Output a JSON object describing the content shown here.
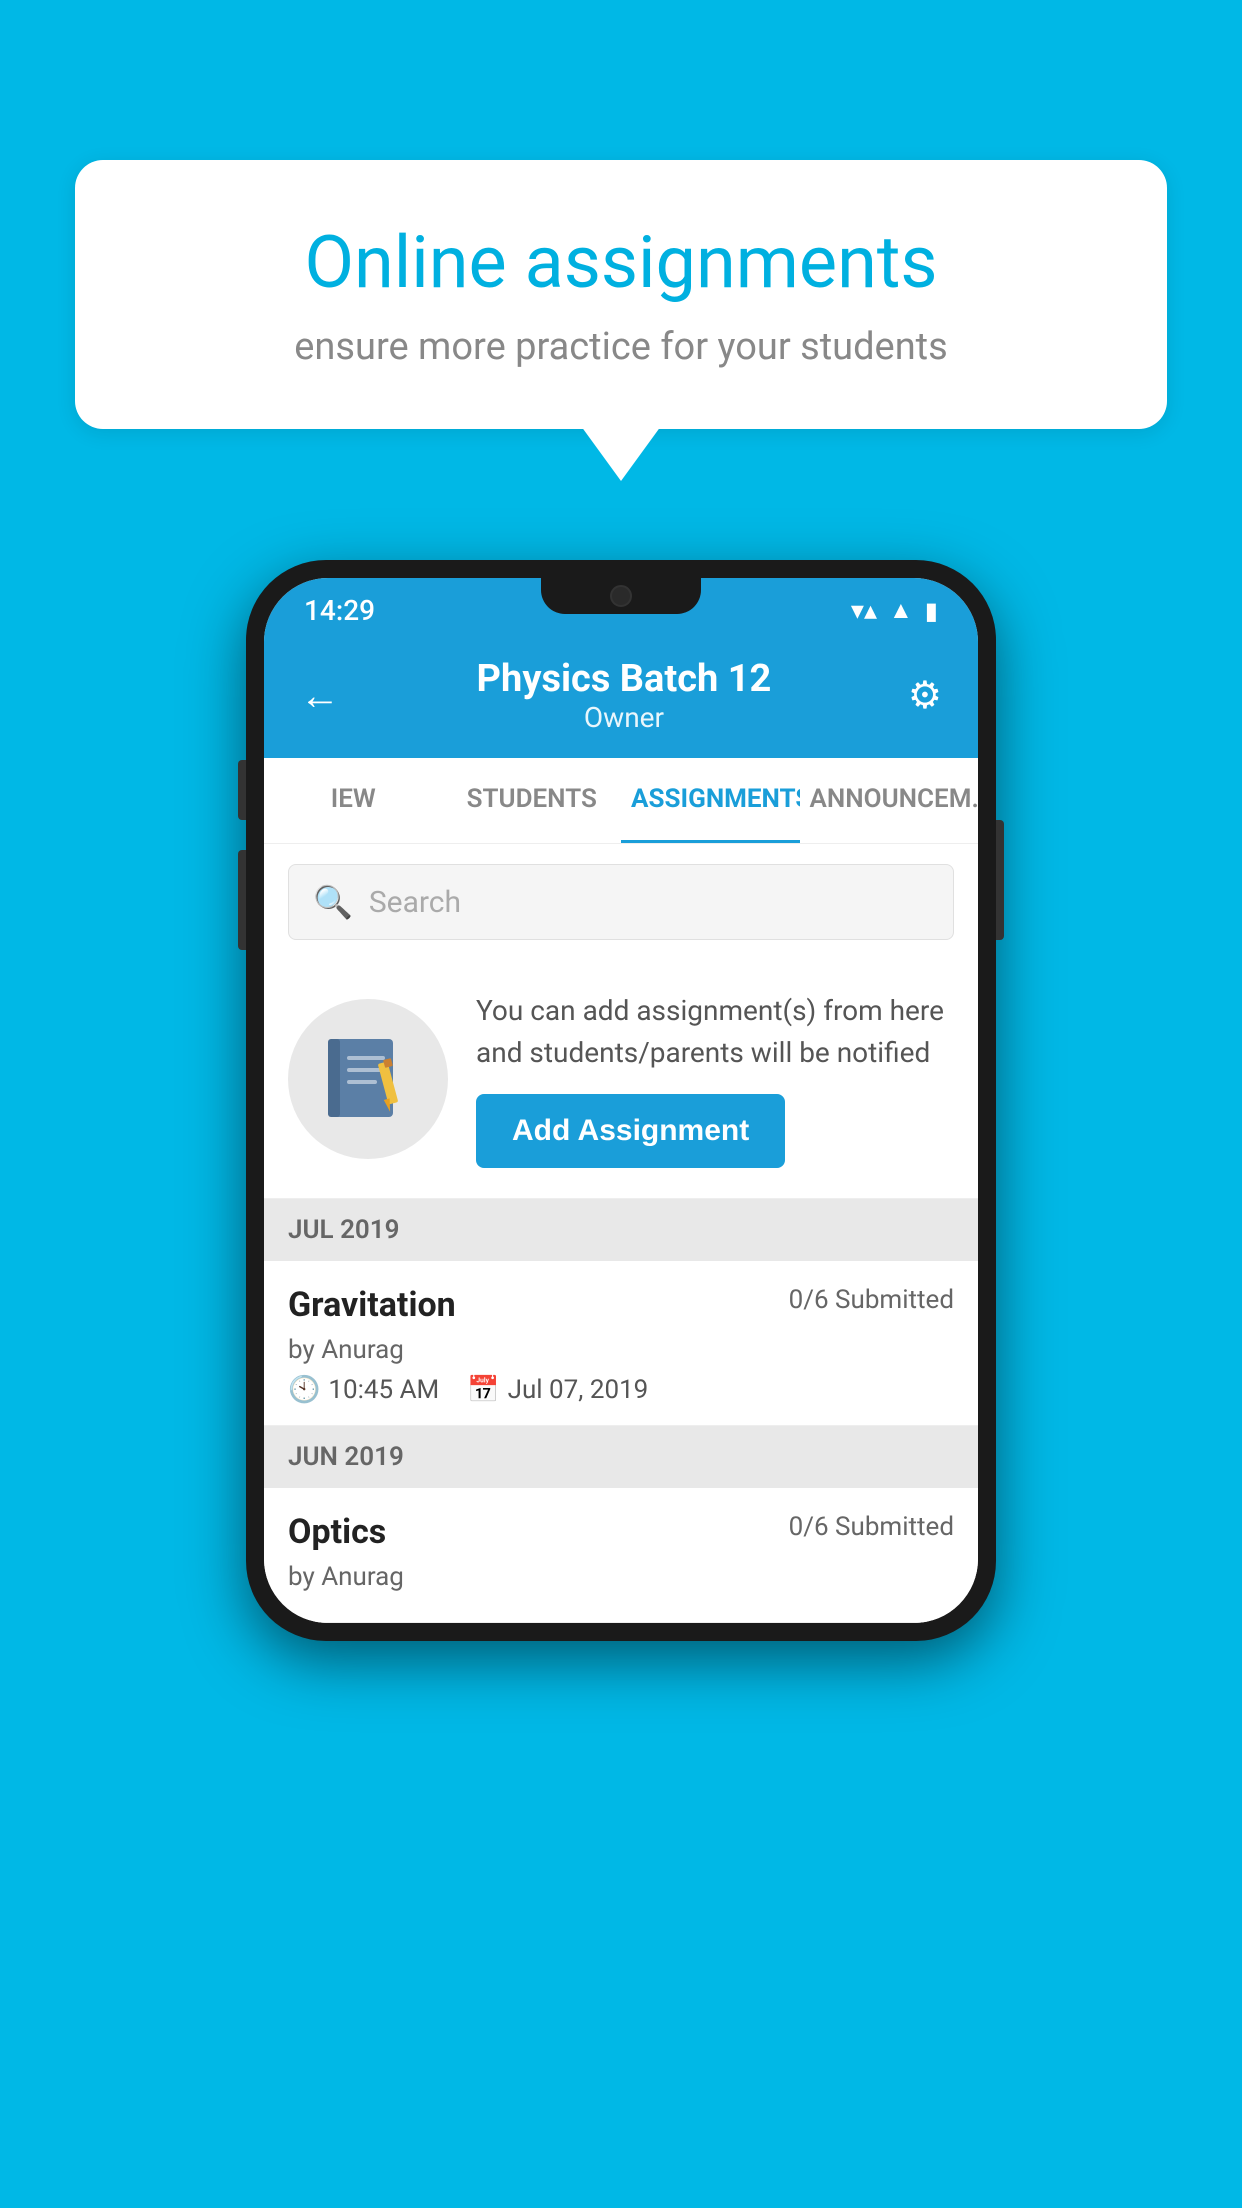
{
  "background": {
    "color": "#00b8e6"
  },
  "speech_bubble": {
    "title": "Online assignments",
    "subtitle": "ensure more practice for your students"
  },
  "phone": {
    "status_bar": {
      "time": "14:29",
      "wifi": "▼",
      "signal": "▲",
      "battery": "▮"
    },
    "header": {
      "title": "Physics Batch 12",
      "subtitle": "Owner",
      "back_icon": "←",
      "settings_icon": "⚙"
    },
    "tabs": [
      {
        "label": "IEW",
        "active": false
      },
      {
        "label": "STUDENTS",
        "active": false
      },
      {
        "label": "ASSIGNMENTS",
        "active": true
      },
      {
        "label": "ANNOUNCEM...",
        "active": false
      }
    ],
    "search": {
      "placeholder": "Search"
    },
    "add_assignment_section": {
      "description": "You can add assignment(s) from here and students/parents will be notified",
      "button_label": "Add Assignment"
    },
    "sections": [
      {
        "label": "JUL 2019",
        "assignments": [
          {
            "name": "Gravitation",
            "submitted": "0/6 Submitted",
            "by": "by Anurag",
            "time": "10:45 AM",
            "date": "Jul 07, 2019"
          }
        ]
      },
      {
        "label": "JUN 2019",
        "assignments": [
          {
            "name": "Optics",
            "submitted": "0/6 Submitted",
            "by": "by Anurag",
            "time": "",
            "date": ""
          }
        ]
      }
    ]
  }
}
